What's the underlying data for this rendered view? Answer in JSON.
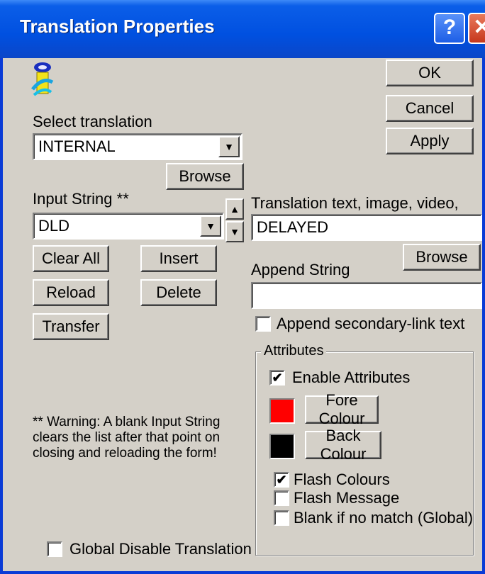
{
  "window": {
    "title": "Translation Properties",
    "help_label": "?",
    "close_label": "✕"
  },
  "buttons": {
    "ok": "OK",
    "cancel": "Cancel",
    "apply": "Apply",
    "browse_translation": "Browse",
    "clear_all": "Clear All",
    "insert": "Insert",
    "reload": "Reload",
    "delete": "Delete",
    "transfer": "Transfer",
    "browse_append": "Browse",
    "fore_colour": "Fore Colour",
    "back_colour": "Back Colour"
  },
  "labels": {
    "select_translation": "Select translation",
    "input_string": "Input String **",
    "translation_text": "Translation text, image, video,",
    "append_string": "Append String",
    "warning_lines": [
      "** Warning: A blank Input String",
      "clears the list after that point on",
      "closing and reloading the form!"
    ]
  },
  "fields": {
    "select_translation_value": "INTERNAL",
    "input_string_value": "DLD",
    "translation_text_value": "DELAYED",
    "append_string_value": ""
  },
  "checkboxes": {
    "append_secondary": {
      "label": "Append secondary-link text",
      "checked": false
    },
    "enable_attributes": {
      "label": "Enable Attributes",
      "checked": true
    },
    "flash_colours": {
      "label": "Flash Colours",
      "checked": true
    },
    "flash_message": {
      "label": "Flash Message",
      "checked": false
    },
    "blank_if_no_match": {
      "label": "Blank if no match (Global)",
      "checked": false
    },
    "global_disable": {
      "label": "Global Disable Translation",
      "checked": false
    }
  },
  "attributes": {
    "group_label": "Attributes",
    "fore_colour": "#ff0000",
    "back_colour": "#000000"
  },
  "icons": {
    "app_icon": "translation-figure-icon",
    "dropdown": "chevron-down-icon",
    "spin_up": "arrow-up-icon",
    "spin_down": "arrow-down-icon"
  },
  "glyphs": {
    "check": "✔",
    "down": "▼",
    "up": "▲"
  }
}
